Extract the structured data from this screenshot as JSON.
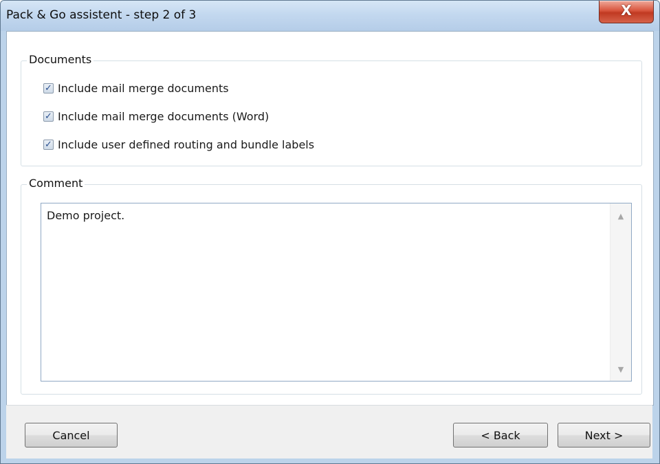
{
  "window": {
    "title": "Pack & Go assistent - step 2 of 3",
    "close_glyph": "X"
  },
  "documents": {
    "legend": "Documents",
    "options": [
      {
        "label": "Include mail merge documents",
        "checked": true
      },
      {
        "label": "Include mail merge documents (Word)",
        "checked": true
      },
      {
        "label": "Include user defined routing and bundle labels",
        "checked": true
      }
    ]
  },
  "comment": {
    "legend": "Comment",
    "value": "Demo project."
  },
  "buttons": {
    "cancel": "Cancel",
    "back": "< Back",
    "next": "Next >"
  },
  "icons": {
    "check": "✓",
    "scroll_up": "▲",
    "scroll_down": "▼"
  },
  "colors": {
    "titlebar": "#c3d8ef",
    "close": "#c8452c",
    "footer": "#f0f0f0"
  }
}
